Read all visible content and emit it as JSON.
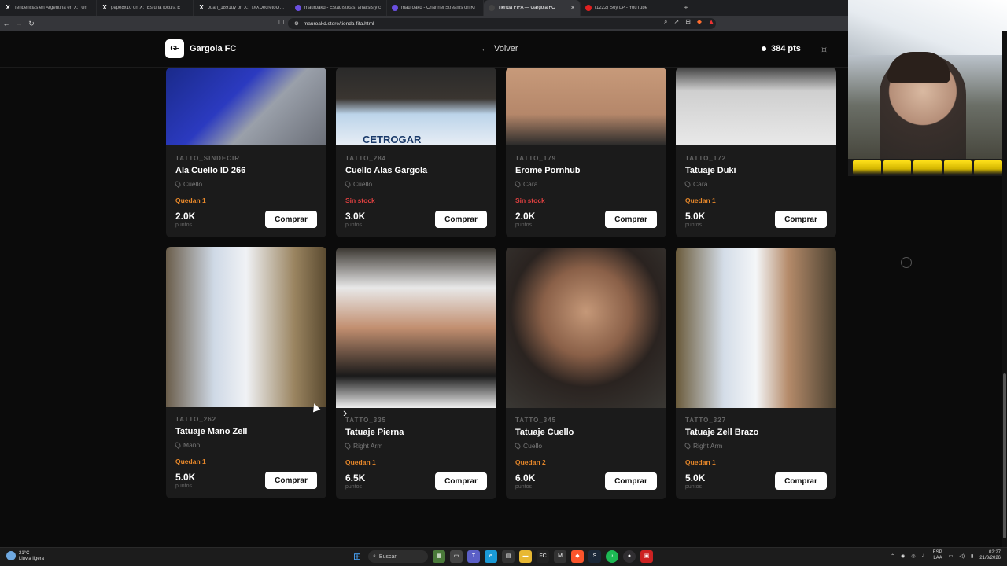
{
  "browser": {
    "tabs": [
      {
        "icon": "x-icon",
        "label": "Tendencias en Argentina en X: \"Un",
        "active": false
      },
      {
        "icon": "x-icon",
        "label": "pepe8x10 on X: \"Es una locura E",
        "active": false
      },
      {
        "icon": "x-icon",
        "label": "Juan_1891uy on X: \"@XDecretoOK A",
        "active": false
      },
      {
        "icon": "twitch-icon",
        "label": "mauroakd - Estadísticas, análisis y c",
        "active": false
      },
      {
        "icon": "twitch-icon",
        "label": "mauroakd - Channel Streams on Ki",
        "active": false
      },
      {
        "icon": "globe-icon",
        "label": "Tienda FIFA — Gargola FC",
        "active": true
      },
      {
        "icon": "youtube-icon",
        "label": "(1222) Soy LP - YouTube",
        "active": false
      }
    ],
    "url": "mauroakd.store/tienda-fifa.html"
  },
  "header": {
    "logo_mark": "GF",
    "logo_text": "Gargola FC",
    "back_label": "Volver",
    "points": "384 pts"
  },
  "products": [
    {
      "code": "TATTO_SINDECIR",
      "name": "Ala Cuello ID 266",
      "location": "Cuello",
      "stock": "Quedan 1",
      "stock_status": "ok",
      "price": "2.0K",
      "unit": "puntos",
      "button": "Comprar"
    },
    {
      "code": "TATTO_284",
      "name": "Cuello Alas Gargola",
      "location": "Cuello",
      "stock": "Sin stock",
      "stock_status": "none",
      "price": "3.0K",
      "unit": "puntos",
      "button": "Comprar"
    },
    {
      "code": "TATTO_179",
      "name": "Erome Pornhub",
      "location": "Cara",
      "stock": "Sin stock",
      "stock_status": "none",
      "price": "2.0K",
      "unit": "puntos",
      "button": "Comprar"
    },
    {
      "code": "TATTO_172",
      "name": "Tatuaje Duki",
      "location": "Cara",
      "stock": "Quedan 1",
      "stock_status": "ok",
      "price": "5.0K",
      "unit": "puntos",
      "button": "Comprar"
    },
    {
      "code": "TATTO_262",
      "name": "Tatuaje Mano Zell",
      "location": "Mano",
      "stock": "Quedan 1",
      "stock_status": "ok",
      "price": "5.0K",
      "unit": "puntos",
      "button": "Comprar"
    },
    {
      "code": "TATTO_335",
      "name": "Tatuaje Pierna",
      "location": "Right Arm",
      "stock": "Quedan 1",
      "stock_status": "ok",
      "price": "6.5K",
      "unit": "puntos",
      "button": "Comprar"
    },
    {
      "code": "TATTO_345",
      "name": "Tatuaje Cuello",
      "location": "Cuello",
      "stock": "Quedan 2",
      "stock_status": "ok",
      "price": "6.0K",
      "unit": "puntos",
      "button": "Comprar"
    },
    {
      "code": "TATTO_327",
      "name": "Tatuaje Zell Brazo",
      "location": "Right Arm",
      "stock": "Quedan 1",
      "stock_status": "ok",
      "price": "5.0K",
      "unit": "puntos",
      "button": "Comprar"
    }
  ],
  "card_images": [
    {
      "logo_text": "CETROGAR"
    }
  ],
  "taskbar": {
    "weather_temp": "21°C",
    "weather_desc": "Lluvia ligera",
    "search_label": "Buscar",
    "lang_top": "ESP",
    "lang_bottom": "LAA",
    "time": "02:27",
    "date": "21/3/2026"
  },
  "colors": {
    "stock_ok": "#e8882a",
    "stock_none": "#e04040",
    "background": "#0b0b0b",
    "card": "#1b1b1b"
  }
}
